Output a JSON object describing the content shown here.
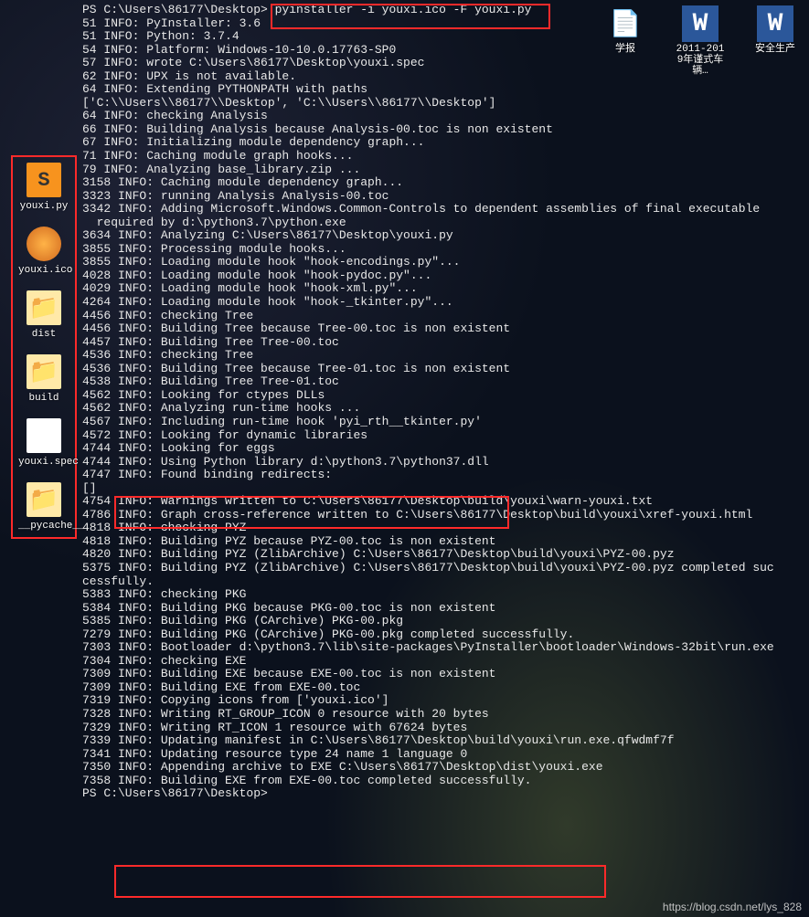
{
  "top_icons": [
    {
      "glyph": "📄",
      "color": "",
      "label": "学报"
    },
    {
      "glyph": "W",
      "class": "word-doc",
      "label": "2011-2019年谨式车辆…"
    },
    {
      "glyph": "W",
      "class": "word-doc",
      "label": "安全生产"
    }
  ],
  "side_icons": [
    {
      "cls": "sublime",
      "glyph": "S",
      "label": "youxi.py"
    },
    {
      "cls": "icofile",
      "glyph": "",
      "label": "youxi.ico"
    },
    {
      "cls": "folder",
      "glyph": "📁",
      "label": "dist"
    },
    {
      "cls": "folder",
      "glyph": "📁",
      "label": "build"
    },
    {
      "cls": "spec",
      "glyph": "",
      "label": "youxi.spec"
    },
    {
      "cls": "folder",
      "glyph": "📁",
      "label": "__pycache__"
    }
  ],
  "prompt": "PS C:\\Users\\86177\\Desktop>",
  "cmd": "pyinstaller -i youxi.ico -F youxi.py",
  "lines": [
    "PS C:\\Users\\86177\\Desktop> pyinstaller -i youxi.ico -F youxi.py",
    "51 INFO: PyInstaller: 3.6",
    "51 INFO: Python: 3.7.4",
    "54 INFO: Platform: Windows-10-10.0.17763-SP0",
    "57 INFO: wrote C:\\Users\\86177\\Desktop\\youxi.spec",
    "62 INFO: UPX is not available.",
    "64 INFO: Extending PYTHONPATH with paths",
    "['C:\\\\Users\\\\86177\\\\Desktop', 'C:\\\\Users\\\\86177\\\\Desktop']",
    "64 INFO: checking Analysis",
    "66 INFO: Building Analysis because Analysis-00.toc is non existent",
    "67 INFO: Initializing module dependency graph...",
    "71 INFO: Caching module graph hooks...",
    "79 INFO: Analyzing base_library.zip ...",
    "3158 INFO: Caching module dependency graph...",
    "3323 INFO: running Analysis Analysis-00.toc",
    "3342 INFO: Adding Microsoft.Windows.Common-Controls to dependent assemblies of final executable",
    "  required by d:\\python3.7\\python.exe",
    "3634 INFO: Analyzing C:\\Users\\86177\\Desktop\\youxi.py",
    "3855 INFO: Processing module hooks...",
    "3855 INFO: Loading module hook \"hook-encodings.py\"...",
    "4028 INFO: Loading module hook \"hook-pydoc.py\"...",
    "4029 INFO: Loading module hook \"hook-xml.py\"...",
    "4264 INFO: Loading module hook \"hook-_tkinter.py\"...",
    "4456 INFO: checking Tree",
    "4456 INFO: Building Tree because Tree-00.toc is non existent",
    "4457 INFO: Building Tree Tree-00.toc",
    "4536 INFO: checking Tree",
    "4536 INFO: Building Tree because Tree-01.toc is non existent",
    "4538 INFO: Building Tree Tree-01.toc",
    "4562 INFO: Looking for ctypes DLLs",
    "4562 INFO: Analyzing run-time hooks ...",
    "4567 INFO: Including run-time hook 'pyi_rth__tkinter.py'",
    "4572 INFO: Looking for dynamic libraries",
    "4744 INFO: Looking for eggs",
    "4744 INFO: Using Python library d:\\python3.7\\python37.dll",
    "4747 INFO: Found binding redirects:",
    "[]",
    "4754 INFO: Warnings written to C:\\Users\\86177\\Desktop\\build\\youxi\\warn-youxi.txt",
    "4786 INFO: Graph cross-reference written to C:\\Users\\86177\\Desktop\\build\\youxi\\xref-youxi.html",
    "4818 INFO: checking PYZ",
    "4818 INFO: Building PYZ because PYZ-00.toc is non existent",
    "4820 INFO: Building PYZ (ZlibArchive) C:\\Users\\86177\\Desktop\\build\\youxi\\PYZ-00.pyz",
    "5375 INFO: Building PYZ (ZlibArchive) C:\\Users\\86177\\Desktop\\build\\youxi\\PYZ-00.pyz completed suc",
    "cessfully.",
    "5383 INFO: checking PKG",
    "5384 INFO: Building PKG because PKG-00.toc is non existent",
    "5385 INFO: Building PKG (CArchive) PKG-00.pkg",
    "7279 INFO: Building PKG (CArchive) PKG-00.pkg completed successfully.",
    "7303 INFO: Bootloader d:\\python3.7\\lib\\site-packages\\PyInstaller\\bootloader\\Windows-32bit\\run.exe",
    "",
    "7304 INFO: checking EXE",
    "7309 INFO: Building EXE because EXE-00.toc is non existent",
    "7309 INFO: Building EXE from EXE-00.toc",
    "7319 INFO: Copying icons from ['youxi.ico']",
    "7328 INFO: Writing RT_GROUP_ICON 0 resource with 20 bytes",
    "7329 INFO: Writing RT_ICON 1 resource with 67624 bytes",
    "7339 INFO: Updating manifest in C:\\Users\\86177\\Desktop\\build\\youxi\\run.exe.qfwdmf7f",
    "7341 INFO: Updating resource type 24 name 1 language 0",
    "7350 INFO: Appending archive to EXE C:\\Users\\86177\\Desktop\\dist\\youxi.exe",
    "7358 INFO: Building EXE from EXE-00.toc completed successfully.",
    "PS C:\\Users\\86177\\Desktop>"
  ],
  "watermark": "https://blog.csdn.net/lys_828"
}
